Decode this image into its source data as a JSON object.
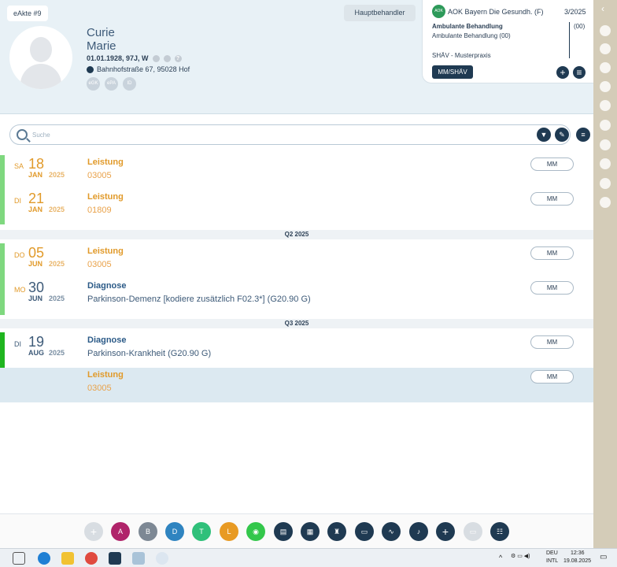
{
  "header": {
    "eakte": "eAkte #9",
    "hauptbehandler": "Hauptbehandler",
    "patient": {
      "lastname": "Curie",
      "firstname": "Marie",
      "birth": "01.01.1928, 97J, W",
      "address": "Bahnhofstraße 67, 95028 Hof",
      "badges": [
        "eGK",
        "ePA",
        "ID"
      ]
    }
  },
  "insurance": {
    "logo": "AOK",
    "name": "AOK Bayern Die Gesundh. (F)",
    "quarter": "3/2025",
    "amb_title": "Ambulante Behandlung",
    "amb_sub": "Ambulante Behandlung (00)",
    "amb_count": "(00)",
    "shav": "SHÄV - Musterpraxis",
    "mm_button": "MM/SHÄV"
  },
  "search": {
    "placeholder": "Suche"
  },
  "entries": [
    {
      "dow": "SA",
      "day": "18",
      "month": "JAN",
      "year": "2025",
      "title": "Leistung",
      "text": "03005",
      "badge": "MM"
    },
    {
      "dow": "DI",
      "day": "21",
      "month": "JAN",
      "year": "2025",
      "title": "Leistung",
      "text": "01809",
      "badge": "MM"
    },
    {
      "dow": "DO",
      "day": "05",
      "month": "JUN",
      "year": "2025",
      "title": "Leistung",
      "text": "03005",
      "badge": "MM"
    },
    {
      "dow": "MO",
      "day": "30",
      "month": "JUN",
      "year": "2025",
      "title": "Diagnose",
      "text": "Parkinson-Demenz [kodiere zusätzlich F02.3*] (G20.90 G)",
      "badge": "MM"
    },
    {
      "dow": "DI",
      "day": "19",
      "month": "AUG",
      "year": "2025",
      "title": "Diagnose",
      "text": "Parkinson-Krankheit (G20.90 G)",
      "badge": "MM"
    },
    {
      "dow": "",
      "day": "",
      "month": "",
      "year": "",
      "title": "Leistung",
      "text": "03005",
      "badge": "MM"
    }
  ],
  "quarters": [
    "Q2  2025",
    "Q3  2025"
  ],
  "toolbar": {
    "letters": [
      "+",
      "A",
      "B",
      "D",
      "T",
      "L"
    ]
  },
  "taskbar": {
    "lang": "DEU",
    "layout": "INTL",
    "time": "12:36",
    "date": "19.08.2025"
  },
  "colors": {
    "navy": "#1f3a52",
    "orange": "#e19a2a",
    "green_bar": "#7fd87f",
    "selected": "#dce9f1"
  }
}
